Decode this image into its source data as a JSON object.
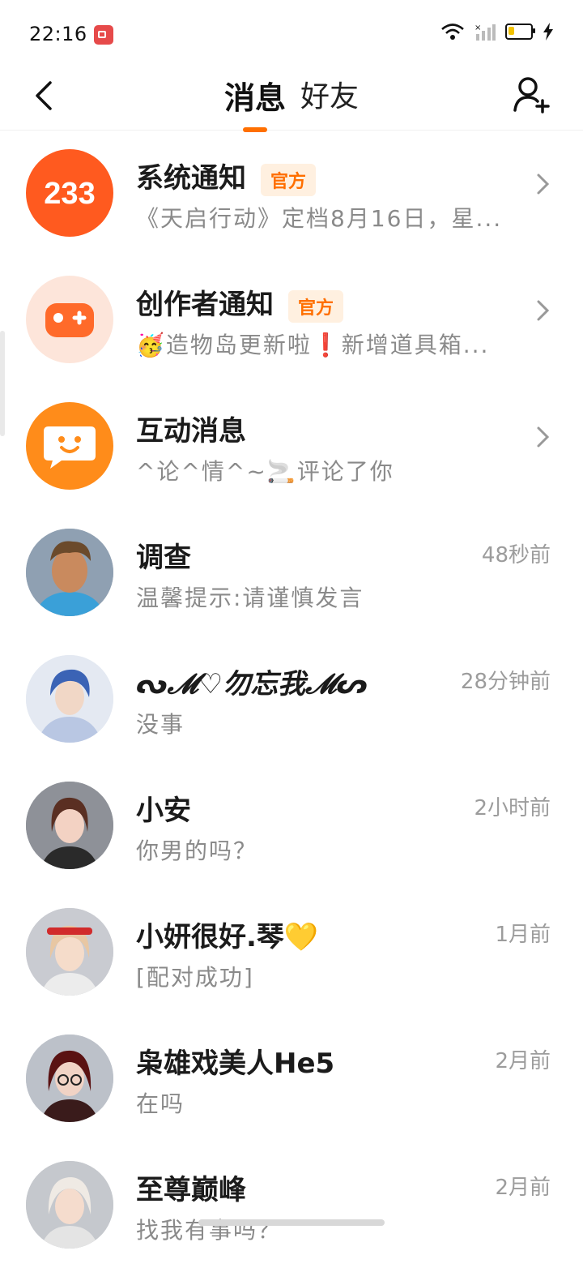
{
  "status": {
    "time": "22:16",
    "battery_level": 0.25
  },
  "header": {
    "tabs": [
      {
        "label": "消息",
        "active": true
      },
      {
        "label": "好友",
        "active": false
      }
    ]
  },
  "colors": {
    "accent": "#ff6f00",
    "badge_bg": "#fff0e0",
    "system_orange": "#ff5a1f",
    "creator_bg": "#fde5da",
    "creator_icon": "#ff6a2a",
    "interact_orange": "#ff8c1a"
  },
  "messages": [
    {
      "name": "系统通知",
      "badge": "官方",
      "preview": "《天启行动》定档8月16日，星...",
      "time": "",
      "avatar": "233",
      "arrow": true
    },
    {
      "name": "创作者通知",
      "badge": "官方",
      "preview": "🥳造物岛更新啦❗新增道具箱...",
      "time": "",
      "avatar": "gamepad-icon",
      "arrow": true
    },
    {
      "name": "互动消息",
      "badge": "",
      "preview": "^论^情^~🚬评论了你",
      "time": "",
      "avatar": "chat-bubble-icon",
      "arrow": true
    },
    {
      "name": "调查",
      "badge": "",
      "preview": "温馨提示:请谨慎发言",
      "time": "48秒前",
      "avatar": "avatar-man",
      "arrow": false
    },
    {
      "name": "勿忘我",
      "badge": "",
      "preview": "没事",
      "time": "28分钟前",
      "avatar": "avatar-blue-hair",
      "arrow": false
    },
    {
      "name": "小安",
      "badge": "",
      "preview": "你男的吗？",
      "time": "2小时前",
      "avatar": "avatar-brown-hair",
      "arrow": false
    },
    {
      "name": "小妍很好.琴💛",
      "badge": "",
      "preview": "[配对成功]",
      "time": "1月前",
      "avatar": "avatar-red-headband",
      "arrow": false
    },
    {
      "name": "枭雄戏美人He5",
      "badge": "",
      "preview": "在吗",
      "time": "2月前",
      "avatar": "avatar-glasses",
      "arrow": false
    },
    {
      "name": "至尊巅峰",
      "badge": "",
      "preview": "找我有事吗？",
      "time": "2月前",
      "avatar": "avatar-white-hair",
      "arrow": false
    }
  ]
}
